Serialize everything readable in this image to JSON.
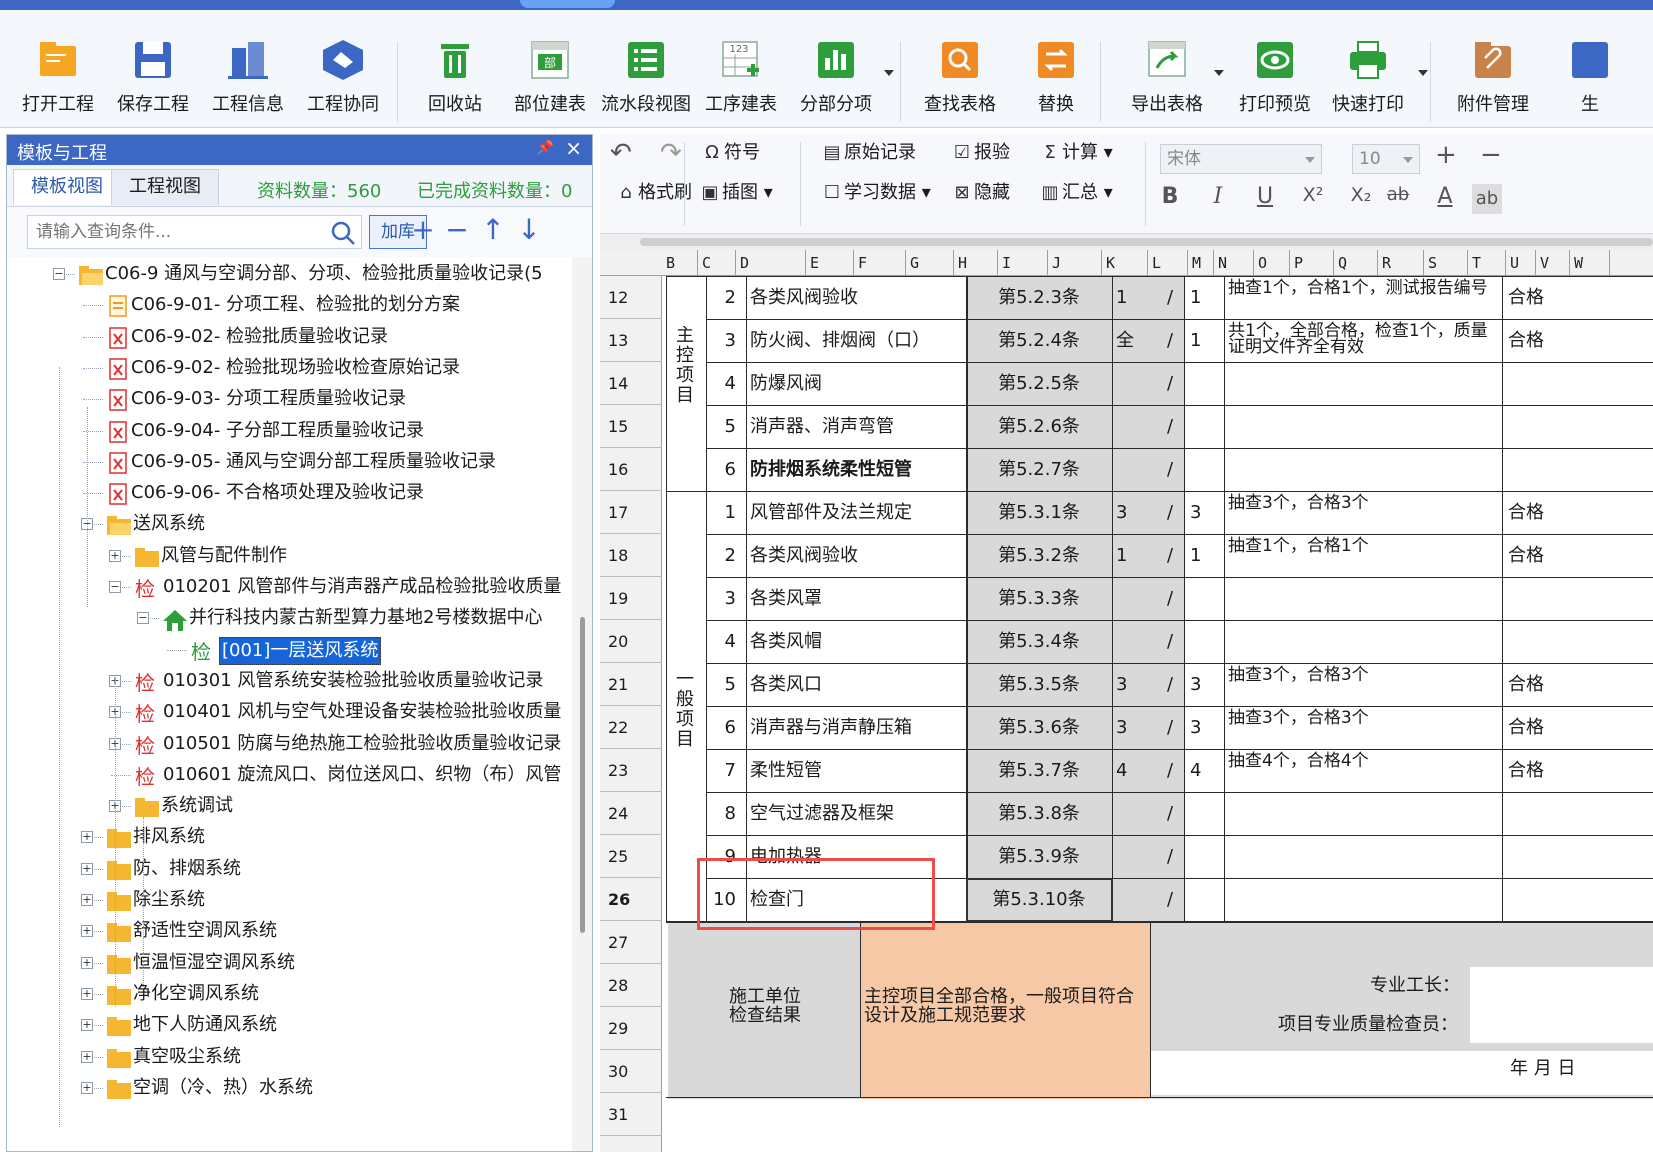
{
  "ribbon": {
    "buttons": [
      {
        "name": "open-project-button",
        "icon": "folder-open-icon",
        "label": "打开工程",
        "color": "#f5a623"
      },
      {
        "name": "save-project-button",
        "icon": "save-icon",
        "label": "保存工程",
        "color": "#3d67c4"
      },
      {
        "name": "project-info-button",
        "icon": "building-icon",
        "label": "工程信息",
        "color": "#3d67c4"
      },
      {
        "name": "project-collab-button",
        "icon": "handshake-icon",
        "label": "工程协同",
        "color": "#3d67c4"
      },
      {
        "name": "recycle-bin-button",
        "icon": "trash-icon",
        "label": "回收站",
        "color": "#2e9d3c"
      },
      {
        "name": "part-table-button",
        "icon": "part-table-icon",
        "label": "部位建表",
        "color": "#2e9d3c"
      },
      {
        "name": "flow-section-view-button",
        "icon": "list-view-icon",
        "label": "流水段视图",
        "color": "#2e9d3c"
      },
      {
        "name": "process-table-button",
        "icon": "grid-add-icon",
        "label": "工序建表",
        "color": "#2e9d3c"
      },
      {
        "name": "subdivision-button",
        "icon": "bar-chart-icon",
        "label": "分部分项",
        "color": "#2e9d3c"
      },
      {
        "name": "find-table-button",
        "icon": "search-icon",
        "label": "查找表格",
        "color": "#f08a24"
      },
      {
        "name": "replace-button",
        "icon": "swap-icon",
        "label": "替换",
        "color": "#f08a24"
      },
      {
        "name": "export-table-button",
        "icon": "export-icon",
        "label": "导出表格",
        "color": "#2e9d3c"
      },
      {
        "name": "print-preview-button",
        "icon": "eye-icon",
        "label": "打印预览",
        "color": "#2e9d3c"
      },
      {
        "name": "quick-print-button",
        "icon": "printer-icon",
        "label": "快速打印",
        "color": "#2e9d3c"
      },
      {
        "name": "attachment-button",
        "icon": "paperclip-icon",
        "label": "附件管理",
        "color": "#c9834a"
      },
      {
        "name": "generate-button",
        "icon": "generate-icon",
        "label": "生",
        "color": "#3d67c4"
      }
    ]
  },
  "left_panel": {
    "title": "模板与工程",
    "pin": "ᴵ",
    "close": "×",
    "tabs": [
      "模板视图",
      "工程视图"
    ],
    "count_label": "资料数量：560",
    "done_label": "已完成资料数量：0",
    "search_placeholder": "请输入查询条件...",
    "add_lib": "加库",
    "tree": [
      {
        "level": 2,
        "type": "folder-open",
        "exp": "−",
        "text": "C06-9 通风与空调分部、分项、检验批质量验收记录(5"
      },
      {
        "level": 3,
        "type": "doc-yellow",
        "text": "C06-9-01- 分项工程、检验批的划分方案"
      },
      {
        "level": 3,
        "type": "doc-red",
        "text": "C06-9-02- 检验批质量验收记录"
      },
      {
        "level": 3,
        "type": "doc-red",
        "text": "C06-9-02- 检验批现场验收检查原始记录"
      },
      {
        "level": 3,
        "type": "doc-red",
        "text": "C06-9-03- 分项工程质量验收记录"
      },
      {
        "level": 3,
        "type": "doc-red",
        "text": "C06-9-04- 子分部工程质量验收记录"
      },
      {
        "level": 3,
        "type": "doc-red",
        "text": "C06-9-05- 通风与空调分部工程质量验收记录"
      },
      {
        "level": 3,
        "type": "doc-red",
        "text": "C06-9-06- 不合格项处理及验收记录"
      },
      {
        "level": 3,
        "type": "folder-open",
        "exp": "−",
        "text": "送风系统"
      },
      {
        "level": 4,
        "type": "folder",
        "exp": "+",
        "text": "风管与配件制作"
      },
      {
        "level": 4,
        "type": "check",
        "exp": "−",
        "text": "010201 风管部件与消声器产成品检验批验收质量"
      },
      {
        "level": 5,
        "type": "house",
        "exp": "−",
        "text": "并行科技内蒙古新型算力基地2号楼数据中心"
      },
      {
        "level": 6,
        "type": "check-green",
        "text": "[001]一层送风系统",
        "selected": true
      },
      {
        "level": 4,
        "type": "check",
        "exp": "+",
        "text": "010301 风管系统安装检验批验收质量验收记录"
      },
      {
        "level": 4,
        "type": "check",
        "exp": "+",
        "text": "010401 风机与空气处理设备安装检验批验收质量"
      },
      {
        "level": 4,
        "type": "check",
        "exp": "+",
        "text": "010501 防腐与绝热施工检验批验收质量验收记录"
      },
      {
        "level": 4,
        "type": "check",
        "text": "010601 旋流风口、岗位送风口、织物（布）风管"
      },
      {
        "level": 4,
        "type": "folder",
        "exp": "+",
        "text": "系统调试"
      },
      {
        "level": 3,
        "type": "folder",
        "exp": "+",
        "text": "排风系统"
      },
      {
        "level": 3,
        "type": "folder",
        "exp": "+",
        "text": "防、排烟系统"
      },
      {
        "level": 3,
        "type": "folder",
        "exp": "+",
        "text": "除尘系统"
      },
      {
        "level": 3,
        "type": "folder",
        "exp": "+",
        "text": "舒适性空调风系统"
      },
      {
        "level": 3,
        "type": "folder",
        "exp": "+",
        "text": "恒温恒湿空调风系统"
      },
      {
        "level": 3,
        "type": "folder",
        "exp": "+",
        "text": "净化空调风系统"
      },
      {
        "level": 3,
        "type": "folder",
        "exp": "+",
        "text": "地下人防通风系统"
      },
      {
        "level": 3,
        "type": "folder",
        "exp": "+",
        "text": "真空吸尘系统"
      },
      {
        "level": 3,
        "type": "folder",
        "exp": "+",
        "text": "空调（冷、热）水系统"
      }
    ],
    "check_glyph": "检"
  },
  "editbar": {
    "undo": "↶",
    "redo": "↷",
    "symbol": "符号",
    "format_brush": "格式刷",
    "insert_image": "插图",
    "raw_record": "原始记录",
    "study_data": "学习数据",
    "report": "报验",
    "hide": "隐藏",
    "calc": "计算",
    "summary": "汇总",
    "font": "宋体",
    "font_size": "10",
    "plus": "+",
    "minus": "−",
    "bold": "B",
    "italic": "I",
    "underline": "U",
    "superscript": "X²",
    "subscript": "X₂",
    "strike": "ab",
    "fontcolor": "A",
    "wrap": "ab"
  },
  "sheet": {
    "columns": [
      "B",
      "C",
      "D",
      "E",
      "F",
      "G",
      "H",
      "I",
      "J",
      "K",
      "L",
      "M",
      "N",
      "O",
      "P",
      "Q",
      "R",
      "S",
      "T",
      "U",
      "V",
      "W"
    ],
    "row_numbers": [
      "12",
      "13",
      "14",
      "15",
      "16",
      "17",
      "18",
      "19",
      "20",
      "21",
      "22",
      "23",
      "24",
      "25",
      "26",
      "27",
      "28",
      "29",
      "30",
      "31"
    ],
    "current_row": "26",
    "section_main": "主控项目",
    "section_general": "一般项目",
    "rows": [
      {
        "idx": "2",
        "name": "各类风阀验收",
        "clause": "第5.2.3条",
        "min": "1",
        "slash": "/",
        "n": "1",
        "result": "抽查1个，合格1个，测试报告编号",
        "judge": "合格"
      },
      {
        "idx": "3",
        "name": "防火阀、排烟阀（口）",
        "clause": "第5.2.4条",
        "min": "全",
        "slash": "/",
        "n": "1",
        "result": "共1个，全部合格，检查1个，质量证明文件齐全有效",
        "judge": "合格"
      },
      {
        "idx": "4",
        "name": "防爆风阀",
        "clause": "第5.2.5条",
        "min": "",
        "slash": "/",
        "n": "",
        "result": "",
        "judge": ""
      },
      {
        "idx": "5",
        "name": "消声器、消声弯管",
        "clause": "第5.2.6条",
        "min": "",
        "slash": "/",
        "n": "",
        "result": "",
        "judge": ""
      },
      {
        "idx": "6",
        "name": "防排烟系统柔性短管",
        "clause": "第5.2.7条",
        "min": "",
        "slash": "/",
        "n": "",
        "result": "",
        "judge": "",
        "bold": true
      },
      {
        "idx": "1",
        "name": "风管部件及法兰规定",
        "clause": "第5.3.1条",
        "min": "3",
        "slash": "/",
        "n": "3",
        "result": "抽查3个，合格3个",
        "judge": "合格"
      },
      {
        "idx": "2",
        "name": "各类风阀验收",
        "clause": "第5.3.2条",
        "min": "1",
        "slash": "/",
        "n": "1",
        "result": "抽查1个，合格1个",
        "judge": "合格"
      },
      {
        "idx": "3",
        "name": "各类风罩",
        "clause": "第5.3.3条",
        "min": "",
        "slash": "/",
        "n": "",
        "result": "",
        "judge": ""
      },
      {
        "idx": "4",
        "name": "各类风帽",
        "clause": "第5.3.4条",
        "min": "",
        "slash": "/",
        "n": "",
        "result": "",
        "judge": ""
      },
      {
        "idx": "5",
        "name": "各类风口",
        "clause": "第5.3.5条",
        "min": "3",
        "slash": "/",
        "n": "3",
        "result": "抽查3个，合格3个",
        "judge": "合格"
      },
      {
        "idx": "6",
        "name": "消声器与消声静压箱",
        "clause": "第5.3.6条",
        "min": "3",
        "slash": "/",
        "n": "3",
        "result": "抽查3个，合格3个",
        "judge": "合格"
      },
      {
        "idx": "7",
        "name": "柔性短管",
        "clause": "第5.3.7条",
        "min": "4",
        "slash": "/",
        "n": "4",
        "result": "抽查4个，合格4个",
        "judge": "合格"
      },
      {
        "idx": "8",
        "name": "空气过滤器及框架",
        "clause": "第5.3.8条",
        "min": "",
        "slash": "/",
        "n": "",
        "result": "",
        "judge": ""
      },
      {
        "idx": "9",
        "name": "电加热器",
        "clause": "第5.3.9条",
        "min": "",
        "slash": "/",
        "n": "",
        "result": "",
        "judge": ""
      },
      {
        "idx": "10",
        "name": "检查门",
        "clause": "第5.3.10条",
        "min": "",
        "slash": "/",
        "n": "",
        "result": "",
        "judge": ""
      }
    ],
    "footer": {
      "unit_label": "施工单位\n检查结果",
      "unit_result": "主控项目全部合格，一般项目符合设计及施工规范要求",
      "foreman": "专业工长：",
      "inspector": "项目专业质量检查员：",
      "date": "年   月   日"
    }
  }
}
